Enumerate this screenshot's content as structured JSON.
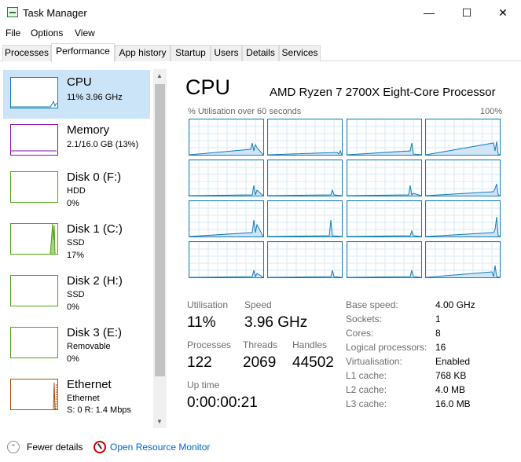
{
  "window": {
    "title": "Task Manager",
    "minimize_glyph": "—",
    "maximize_glyph": "☐",
    "close_glyph": "✕"
  },
  "menu": [
    "File",
    "Options",
    "View"
  ],
  "tabs": [
    {
      "label": "Processes",
      "active": false
    },
    {
      "label": "Performance",
      "active": true
    },
    {
      "label": "App history",
      "active": false
    },
    {
      "label": "Startup",
      "active": false
    },
    {
      "label": "Users",
      "active": false
    },
    {
      "label": "Details",
      "active": false
    },
    {
      "label": "Services",
      "active": false
    }
  ],
  "sidebar": {
    "items": [
      {
        "title": "CPU",
        "line1": "11% 3.96 GHz",
        "line2": "",
        "color": "#117dbb",
        "selected": true
      },
      {
        "title": "Memory",
        "line1": "2.1/16.0 GB (13%)",
        "line2": "",
        "color": "#8b12ae",
        "selected": false
      },
      {
        "title": "Disk 0 (F:)",
        "line1": "HDD",
        "line2": "0%",
        "color": "#4da60c",
        "selected": false
      },
      {
        "title": "Disk 1 (C:)",
        "line1": "SSD",
        "line2": "17%",
        "color": "#4da60c",
        "selected": false
      },
      {
        "title": "Disk 2 (H:)",
        "line1": "SSD",
        "line2": "0%",
        "color": "#4da60c",
        "selected": false
      },
      {
        "title": "Disk 3 (E:)",
        "line1": "Removable",
        "line2": "0%",
        "color": "#4da60c",
        "selected": false
      },
      {
        "title": "Ethernet",
        "line1": "Ethernet",
        "line2": "S: 0 R: 1.4 Mbps",
        "color": "#a74f01",
        "selected": false
      }
    ],
    "scroll_up_glyph": "▲",
    "scroll_down_glyph": "▼"
  },
  "main": {
    "title": "CPU",
    "processor": "AMD Ryzen 7 2700X Eight-Core Processor",
    "graph_label": "% Utilisation over 60 seconds",
    "graph_max": "100%",
    "core_count_shown": 16,
    "accent_color": "#117dbb",
    "stats": {
      "utilisation_label": "Utilisation",
      "utilisation_value": "11%",
      "speed_label": "Speed",
      "speed_value": "3.96 GHz",
      "processes_label": "Processes",
      "processes_value": "122",
      "threads_label": "Threads",
      "threads_value": "2069",
      "handles_label": "Handles",
      "handles_value": "44502",
      "uptime_label": "Up time",
      "uptime_value": "0:00:00:21"
    },
    "details": [
      {
        "label": "Base speed:",
        "value": "4.00 GHz"
      },
      {
        "label": "Sockets:",
        "value": "1"
      },
      {
        "label": "Cores:",
        "value": "8"
      },
      {
        "label": "Logical processors:",
        "value": "16"
      },
      {
        "label": "Virtualisation:",
        "value": "Enabled"
      },
      {
        "label": "L1 cache:",
        "value": "768 KB"
      },
      {
        "label": "L2 cache:",
        "value": "4.0 MB"
      },
      {
        "label": "L3 cache:",
        "value": "16.0 MB"
      }
    ]
  },
  "footer": {
    "fewer_details": "Fewer details",
    "fewer_glyph": "⌃",
    "resource_monitor": "Open Resource Monitor"
  }
}
